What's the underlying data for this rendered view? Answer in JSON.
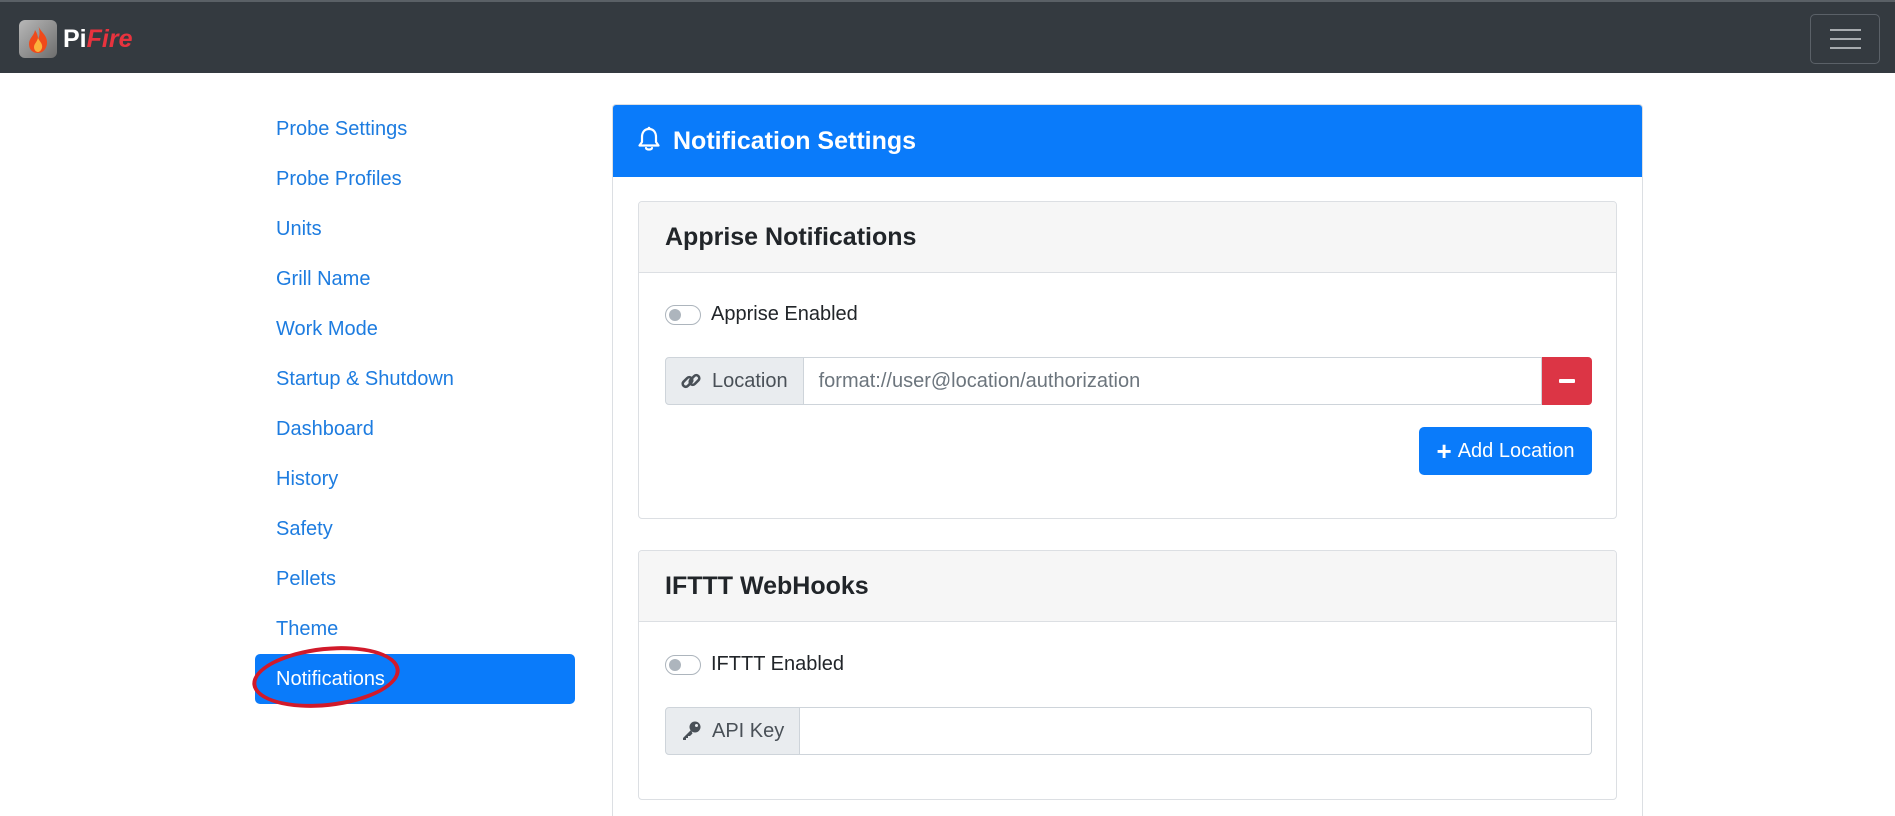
{
  "brand": {
    "name_part1": "Pi",
    "name_part2": "Fire",
    "logo_icon": "flame-icon"
  },
  "navbar": {
    "menu_icon": "hamburger-menu-icon"
  },
  "sidebar": {
    "items": [
      {
        "label": "Probe Settings"
      },
      {
        "label": "Probe Profiles"
      },
      {
        "label": "Units"
      },
      {
        "label": "Grill Name"
      },
      {
        "label": "Work Mode"
      },
      {
        "label": "Startup & Shutdown"
      },
      {
        "label": "Dashboard"
      },
      {
        "label": "History"
      },
      {
        "label": "Safety"
      },
      {
        "label": "Pellets"
      },
      {
        "label": "Theme"
      },
      {
        "label": "Notifications",
        "active": true
      }
    ]
  },
  "main": {
    "title": "Notification Settings",
    "title_icon": "bell-icon",
    "apprise": {
      "title": "Apprise Notifications",
      "toggle_label": "Apprise Enabled",
      "enabled": false,
      "location_label": "Location",
      "location_icon": "link-icon",
      "location_placeholder": "format://user@location/authorization",
      "remove_icon": "minus-icon",
      "add_button_label": "Add Location"
    },
    "ifttt": {
      "title": "IFTTT WebHooks",
      "toggle_label": "IFTTT Enabled",
      "enabled": false,
      "api_key_label": "API Key",
      "api_key_icon": "key-icon",
      "api_key_value": ""
    }
  },
  "colors": {
    "navbar": "#343a40",
    "primary": "#0a7bfa",
    "danger": "#dc3545",
    "link": "#1d7ce0",
    "annotation": "#d11a2a"
  }
}
